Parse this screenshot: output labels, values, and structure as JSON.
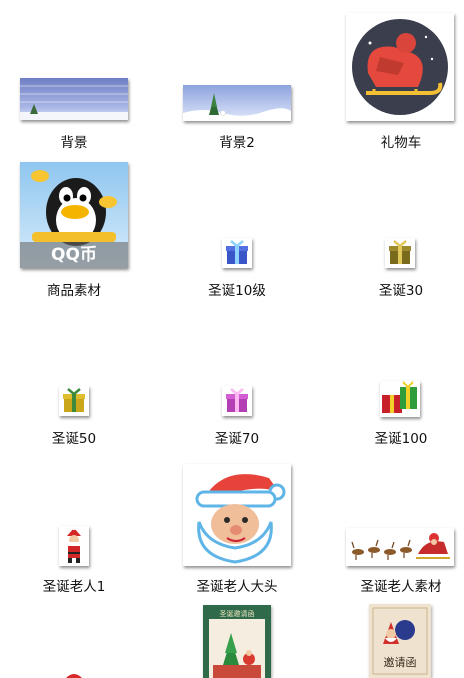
{
  "items": [
    {
      "label": "背景",
      "thumb": "snow-banner"
    },
    {
      "label": "背景2",
      "thumb": "snow-tree-banner"
    },
    {
      "label": "礼物车",
      "thumb": "santa-sleigh-icon"
    },
    {
      "label": "商品素材",
      "thumb": "qq-coin-penguin"
    },
    {
      "label": "圣诞10级",
      "thumb": "gift-blue-icon"
    },
    {
      "label": "圣诞30",
      "thumb": "gift-olive-icon"
    },
    {
      "label": "圣诞50",
      "thumb": "gift-yellow-icon"
    },
    {
      "label": "圣诞70",
      "thumb": "gift-purple-icon"
    },
    {
      "label": "圣诞100",
      "thumb": "gift-red-green-icon"
    },
    {
      "label": "圣诞老人1",
      "thumb": "santa-small-icon"
    },
    {
      "label": "圣诞老人大头",
      "thumb": "santa-head"
    },
    {
      "label": "圣诞老人素材",
      "thumb": "reindeer-sleigh-banner"
    },
    {
      "label": "",
      "thumb": "partial-red"
    },
    {
      "label": "",
      "thumb": "invitation-green"
    },
    {
      "label": "",
      "thumb": "invitation-card"
    }
  ],
  "thumb_texts": {
    "qq_coin": "QQ币",
    "invitation_header": "圣诞邀请函",
    "invitation_title": "邀请函"
  },
  "colors": {
    "label": "#111111",
    "background": "#ffffff"
  }
}
